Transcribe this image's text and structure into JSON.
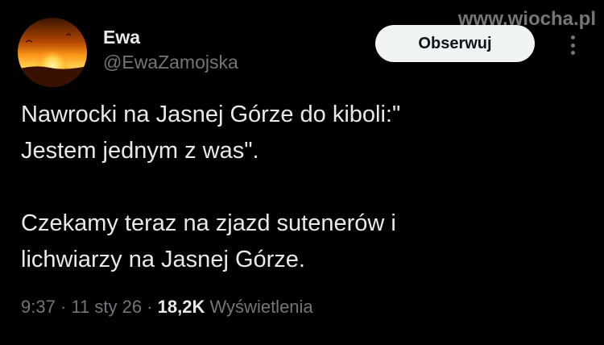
{
  "watermark": "www.wiocha.pl",
  "author": {
    "display_name": "Ewa",
    "handle": "@EwaZamojska"
  },
  "follow_button_label": "Obserwuj",
  "more_icon": "more-dots-icon",
  "tweet": {
    "lines": [
      "Nawrocki na Jasnej Górze do kiboli:\"",
      "Jestem jednym z was\".",
      "Czekamy teraz na zjazd sutenerów i",
      "lichwiarzy na Jasnej Górze."
    ]
  },
  "meta": {
    "time": "9:37",
    "separator": "·",
    "date": "11 sty 26",
    "views_count": "18,2K",
    "views_label": "Wyświetlenia"
  },
  "colors": {
    "background": "#000000",
    "text_primary": "#e7e9ea",
    "text_secondary": "#71767b",
    "button_bg": "#eff3f4"
  }
}
